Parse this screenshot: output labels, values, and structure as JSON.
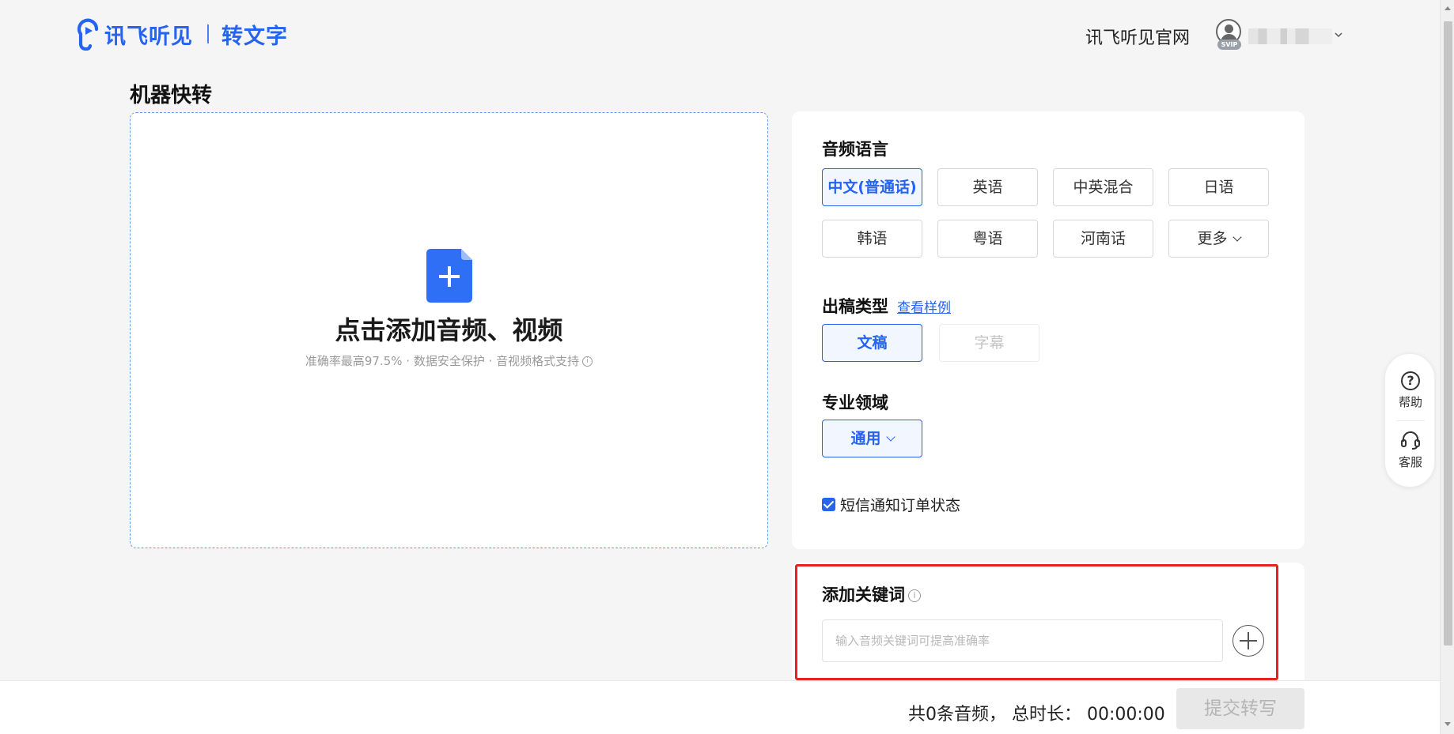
{
  "header": {
    "logo_text": "讯飞听见",
    "logo_sub": "转文字",
    "official_link": "讯飞听见官网",
    "badge": "SVIP"
  },
  "page_title": "机器快转",
  "upload": {
    "title": "点击添加音频、视频",
    "subtitle": "准确率最高97.5% · 数据安全保护 · 音视频格式支持"
  },
  "settings": {
    "language_title": "音频语言",
    "languages": [
      "中文(普通话)",
      "英语",
      "中英混合",
      "日语",
      "韩语",
      "粤语",
      "河南话",
      "更多"
    ],
    "output_title": "出稿类型",
    "output_sample_link": "查看样例",
    "outputs": [
      "文稿",
      "字幕"
    ],
    "domain_title": "专业领域",
    "domain_value": "通用",
    "sms_label": "短信通知订单状态"
  },
  "keywords": {
    "title": "添加关键词",
    "placeholder": "输入音频关键词可提高准确率"
  },
  "footer": {
    "count_text": "共0条音频，  总时长：  00:00:00",
    "submit": "提交转写"
  },
  "float": {
    "help": "帮助",
    "service": "客服"
  },
  "colors": {
    "accent": "#2563f0",
    "highlight": "#e62222"
  }
}
